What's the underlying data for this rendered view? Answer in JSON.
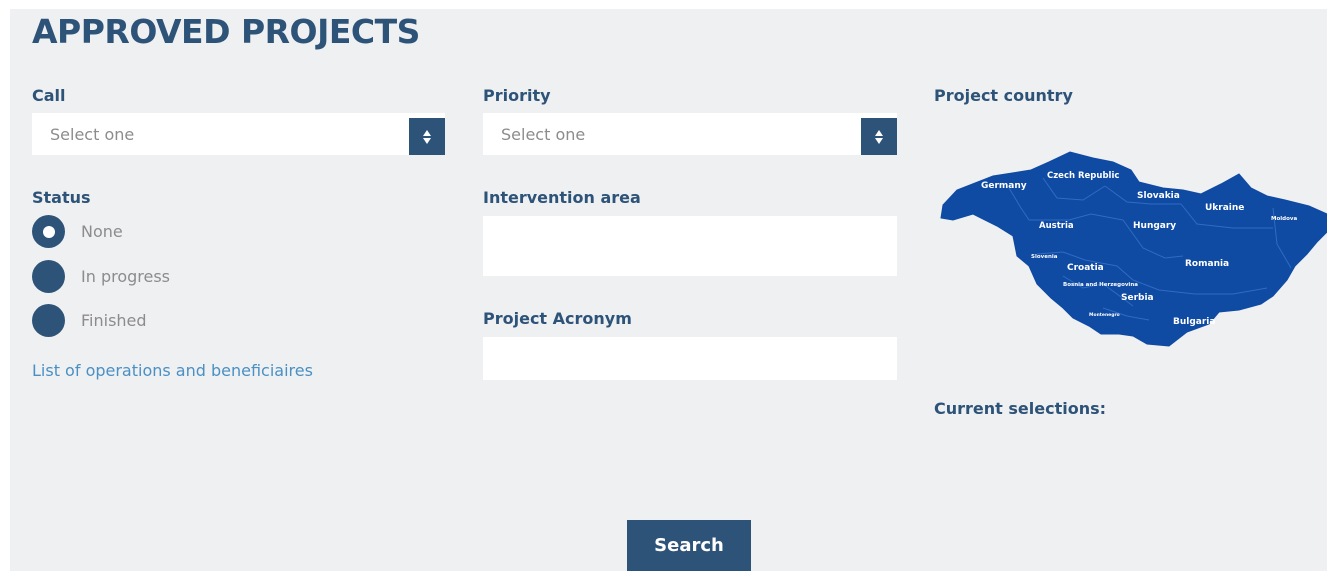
{
  "page": {
    "title": "APPROVED PROJECTS"
  },
  "filters": {
    "call": {
      "label": "Call",
      "value": "Select one"
    },
    "priority": {
      "label": "Priority",
      "value": "Select one"
    },
    "status": {
      "label": "Status",
      "options": [
        {
          "label": "None",
          "selected": true
        },
        {
          "label": "In progress",
          "selected": false
        },
        {
          "label": "Finished",
          "selected": false
        }
      ]
    },
    "intervention_area": {
      "label": "Intervention area",
      "value": ""
    },
    "project_acronym": {
      "label": "Project Acronym",
      "value": ""
    },
    "project_country": {
      "label": "Project country",
      "countries": [
        "Germany",
        "Czech Republic",
        "Slovakia",
        "Ukraine",
        "Moldova",
        "Austria",
        "Hungary",
        "Slovenia",
        "Croatia",
        "Romania",
        "Bosnia and Herzegovina",
        "Serbia",
        "Montenegro",
        "Bulgaria"
      ]
    }
  },
  "links": {
    "operations": "List of operations and beneficiaires"
  },
  "current_selections": {
    "label": "Current selections:"
  },
  "actions": {
    "search": "Search"
  },
  "colors": {
    "accent": "#2e5378",
    "map": "#0f4aa3",
    "background": "#eff0f2",
    "link": "#4a90c4"
  }
}
